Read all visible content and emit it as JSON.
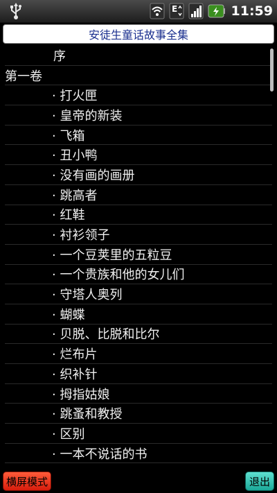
{
  "status_bar": {
    "time": "11:59",
    "network_type": "E",
    "icons": [
      "usb-icon",
      "wifi-icon",
      "network-e-icon",
      "signal-icon",
      "battery-icon"
    ]
  },
  "header": {
    "title": "安徒生童话故事全集"
  },
  "toc": {
    "preface": "序",
    "volume1": "第一卷",
    "items": [
      "· 打火匣",
      "· 皇帝的新装",
      "· 飞箱",
      "· 丑小鸭",
      "· 没有画的画册",
      "· 跳高者",
      "· 红鞋",
      "· 衬衫领子",
      "· 一个豆荚里的五粒豆",
      "· 一个贵族和他的女儿们",
      "· 守塔人奥列",
      "· 蝴蝶",
      "· 贝脱、比脱和比尔",
      "· 烂布片",
      "· 织补针",
      "· 拇指姑娘",
      "· 跳蚤和教授",
      "· 区别",
      "· 一本不说话的书"
    ]
  },
  "bottom": {
    "landscape_label": "横屏模式",
    "exit_label": "退出"
  },
  "colors": {
    "title_text": "#1a2f8f",
    "landscape_button": "#e8321a",
    "exit_button": "#33c4b4"
  }
}
